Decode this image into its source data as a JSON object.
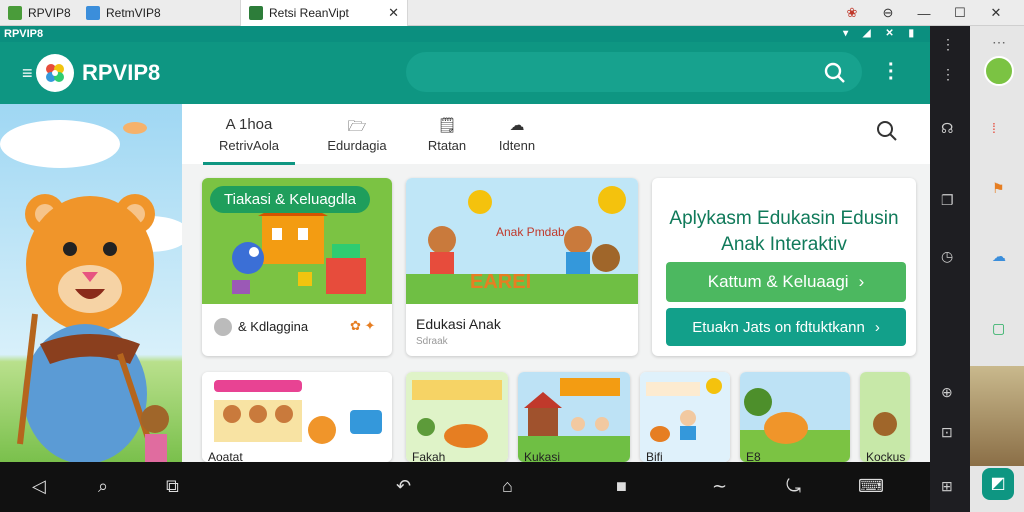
{
  "window": {
    "tabs": [
      {
        "label": "RPVIP8",
        "color": "#4a9c3a"
      },
      {
        "label": "RetmVIP8",
        "color": "#3b8edb"
      },
      {
        "label": "Retsi ReanVipt",
        "color": "#2d7d3a"
      }
    ],
    "close_glyph": "✕",
    "controls": [
      "⊖",
      "—",
      "☐",
      "✕"
    ]
  },
  "emulator": {
    "title": "RPVIP8",
    "status_icons": "▾ ◢ ✕ ▮"
  },
  "appbar": {
    "brand": "RPVIP8",
    "menu_glyph": "≡",
    "kebab_glyph": "⋮"
  },
  "tabs": [
    {
      "icon": "𝘈",
      "top": "A 1hoa",
      "label": "RetrivAola"
    },
    {
      "icon": "🗁",
      "top": "",
      "label": "Edurdagia"
    },
    {
      "icon": "🗒",
      "top": "",
      "label": "Rtatan"
    },
    {
      "icon": "☁",
      "top": "",
      "label": "Idtenn"
    }
  ],
  "cards": {
    "c1": {
      "pill": "Tiakasi & Keluagdla",
      "footer": "& Kdlaggina"
    },
    "c2": {
      "sign": "Anak Pmdab",
      "letters": "EAREI",
      "title": "Edukasi Anak",
      "sub": "Sdraak"
    },
    "promo": {
      "title": "Aplykasm Edukasin Edusin Anak Interaktiv",
      "btn1": "Kattum & Keluaagi",
      "btn2": "Etuakn Jats on fdtuktkann",
      "chev": "›",
      "btn1_color": "#4cb860",
      "btn2_color": "#12a08a"
    }
  },
  "thumbs": [
    {
      "label": "Aoatat"
    },
    {
      "label": "Fakah"
    },
    {
      "label": "Kukasi"
    },
    {
      "label": "Bifi"
    },
    {
      "label": "E8"
    },
    {
      "label": "Kockus"
    }
  ],
  "nav": {
    "left": [
      "◁",
      "⌕",
      "⧉"
    ],
    "right": [
      "↶",
      "⌂",
      "■",
      "∼",
      "⤿",
      "⌨"
    ]
  },
  "sidebar": [
    "⋮",
    "☊",
    "❐",
    "◷",
    "⊕",
    "⊡",
    "⊞",
    "⊟"
  ],
  "colors": {
    "teal": "#0e9682",
    "green": "#1f9e5c"
  }
}
